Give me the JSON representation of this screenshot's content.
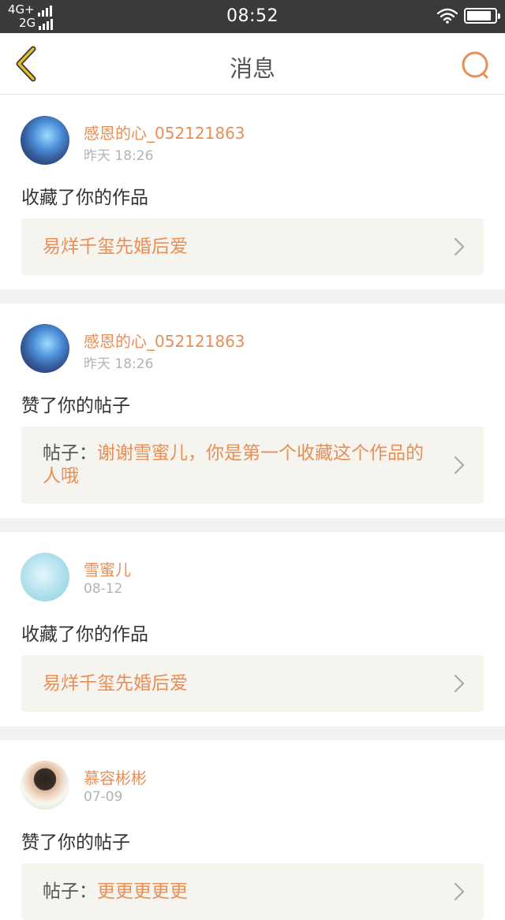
{
  "status": {
    "network_top": "4G+",
    "network_bottom": "2G",
    "time": "08:52"
  },
  "nav": {
    "title": "消息",
    "back_icon": "chevron-left-icon",
    "search_icon": "search-icon"
  },
  "colors": {
    "accent": "#e88f57",
    "back_arrow": "#e4c02c",
    "card_bg": "#f5f4ee",
    "divider": "#f2f2f2"
  },
  "feed": [
    {
      "username": "感恩的心_052121863",
      "time": "昨天 18:26",
      "action": "收藏了你的作品",
      "target_prefix": "",
      "target_text": "易烊千玺先婚后爱"
    },
    {
      "username": "感恩的心_052121863",
      "time": "昨天 18:26",
      "action": "赞了你的帖子",
      "target_prefix": "帖子：",
      "target_text": "谢谢雪蜜儿，你是第一个收藏这个作品的人哦"
    },
    {
      "username": "雪蜜儿",
      "time": "08-12",
      "action": "收藏了你的作品",
      "target_prefix": "",
      "target_text": "易烊千玺先婚后爱"
    },
    {
      "username": "慕容彬彬",
      "time": "07-09",
      "action": "赞了你的帖子",
      "target_prefix": "帖子：",
      "target_text": "更更更更更"
    }
  ]
}
